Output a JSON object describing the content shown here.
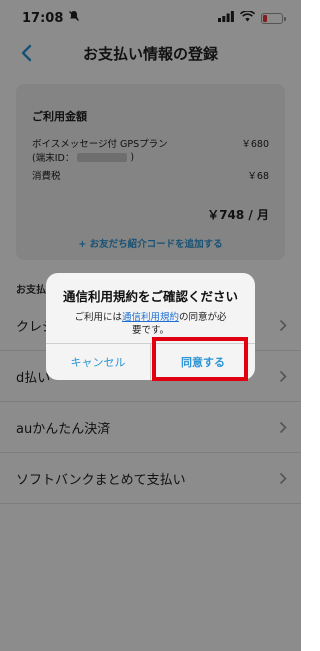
{
  "status_bar": {
    "time": "17:08"
  },
  "nav": {
    "title": "お支払い情報の登録"
  },
  "summary": {
    "title": "ご利用金額",
    "plan_name": "ボイスメッセージ付 GPSプラン",
    "plan_price": "￥680",
    "terminal_label": "(端末ID：",
    "terminal_close": ")",
    "tax_label": "消費税",
    "tax_price": "￥68",
    "total": "￥748 / 月",
    "add_code": "+ お友だち紹介コードを追加する"
  },
  "section_label": "お支払い方法",
  "methods": [
    {
      "label": "クレジットカード"
    },
    {
      "label": "d払い"
    },
    {
      "label": "auかんたん決済"
    },
    {
      "label": "ソフトバンクまとめて支払い"
    }
  ],
  "dialog": {
    "title": "通信利用規約をご確認ください",
    "body_prefix": "ご利用には",
    "body_link": "通信利用規約",
    "body_suffix_1": "の同意が必",
    "body_suffix_2": "要です。",
    "cancel": "キャンセル",
    "agree": "同意する"
  },
  "colors": {
    "accent": "#2b95d6",
    "highlight": "#e1000f",
    "overlay": "rgba(0,0,0,0.45)"
  }
}
